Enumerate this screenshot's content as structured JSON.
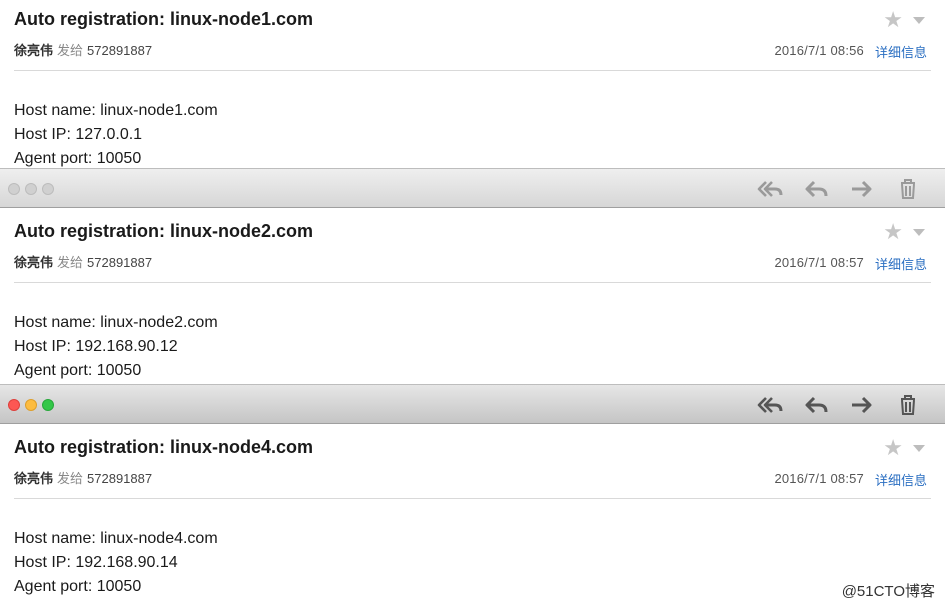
{
  "emails": [
    {
      "subject": "Auto registration: linux-node1.com",
      "sender": "徐亮伟",
      "verb": "发给",
      "recipient": "572891887",
      "date": "2016/7/1  08:56",
      "details_label": "详细信息",
      "body": {
        "host_name": "Host name: linux-node1.com",
        "host_ip": "Host IP: 127.0.0.1",
        "agent_port": "Agent port: 10050"
      }
    },
    {
      "subject": "Auto registration: linux-node2.com",
      "sender": "徐亮伟",
      "verb": "发给",
      "recipient": "572891887",
      "date": "2016/7/1  08:57",
      "details_label": "详细信息",
      "body": {
        "host_name": "Host name: linux-node2.com",
        "host_ip": "Host IP: 192.168.90.12",
        "agent_port": "Agent port: 10050"
      }
    },
    {
      "subject": "Auto registration: linux-node4.com",
      "sender": "徐亮伟",
      "verb": "发给",
      "recipient": "572891887",
      "date": "2016/7/1  08:57",
      "details_label": "详细信息",
      "body": {
        "host_name": "Host name: linux-node4.com",
        "host_ip": "Host IP: 192.168.90.14",
        "agent_port": "Agent port: 10050"
      }
    }
  ],
  "toolbar_icons": [
    "reply-all-icon",
    "reply-icon",
    "forward-icon",
    "trash-icon"
  ],
  "icons": {
    "star": "star-icon",
    "caret": "chevron-down-icon"
  },
  "colors": {
    "link": "#2b6fc2",
    "close": "#fc5753",
    "minimize": "#fdbc40",
    "zoom": "#33c748",
    "inactive_light": "#d0d0d0"
  },
  "watermark": "@51CTO博客"
}
